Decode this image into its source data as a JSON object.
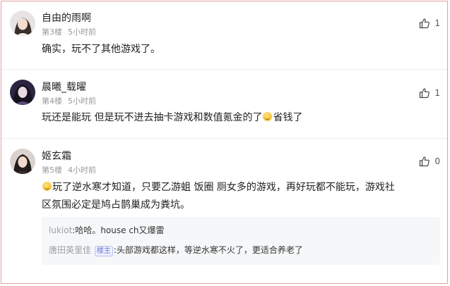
{
  "comments": [
    {
      "username": "自由的雨啊",
      "floor": "第3楼",
      "time": "5小时前",
      "likes": "1",
      "text": "确实，玩不了其他游戏了。"
    },
    {
      "username": "晨曦_载曜",
      "floor": "第4楼",
      "time": "5小时前",
      "likes": "1",
      "text_before": "玩还是能玩 但是玩不进去抽卡游戏和数值氪金的了",
      "text_after": "省钱了"
    },
    {
      "username": "姬玄霜",
      "floor": "第5楼",
      "time": "4小时前",
      "likes": "0",
      "text_line1": "玩了逆水寒才知道，只要乙游蛆 饭圈 厕女多的游戏，再好玩都不能玩，游戏社",
      "text_line2": "区氛围必定是鸠占鹊巢成为粪坑。",
      "replies": [
        {
          "username": "lukiot",
          "sep": ":",
          "text": "哈哈。house ch又爆雷"
        },
        {
          "username": "唐田英里佳",
          "badge": "楼主",
          "sep": ":",
          "text": "头部游戏都这样，等逆水寒不火了，更适合养老了"
        }
      ]
    }
  ],
  "icons": {
    "like": "thumbs-up-icon",
    "emoji": "smile-emoji-icon"
  }
}
